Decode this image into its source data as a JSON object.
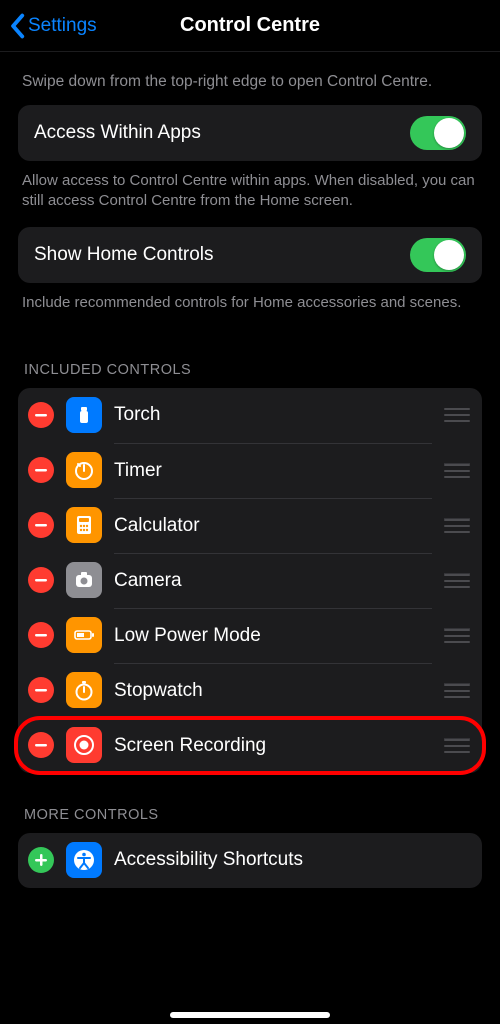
{
  "header": {
    "back_label": "Settings",
    "title": "Control Centre"
  },
  "intro_help": "Swipe down from the top-right edge to open Control Centre.",
  "access_within_apps": {
    "title": "Access Within Apps",
    "help": "Allow access to Control Centre within apps. When disabled, you can still access Control Centre from the Home screen.",
    "enabled": true
  },
  "show_home_controls": {
    "title": "Show Home Controls",
    "help": "Include recommended controls for Home accessories and scenes.",
    "enabled": true
  },
  "included_header": "INCLUDED CONTROLS",
  "included": [
    {
      "label": "Torch",
      "icon": "torch",
      "icon_bg": "#007aff"
    },
    {
      "label": "Timer",
      "icon": "timer",
      "icon_bg": "#ff9500"
    },
    {
      "label": "Calculator",
      "icon": "calculator",
      "icon_bg": "#ff9500"
    },
    {
      "label": "Camera",
      "icon": "camera",
      "icon_bg": "#8e8e93"
    },
    {
      "label": "Low Power Mode",
      "icon": "battery",
      "icon_bg": "#ff9500"
    },
    {
      "label": "Stopwatch",
      "icon": "stopwatch",
      "icon_bg": "#ff9500"
    },
    {
      "label": "Screen Recording",
      "icon": "record",
      "icon_bg": "#ff3b30"
    }
  ],
  "more_header": "MORE CONTROLS",
  "more": [
    {
      "label": "Accessibility Shortcuts",
      "icon": "accessibility",
      "icon_bg": "#007aff"
    }
  ],
  "highlighted_index": 6
}
